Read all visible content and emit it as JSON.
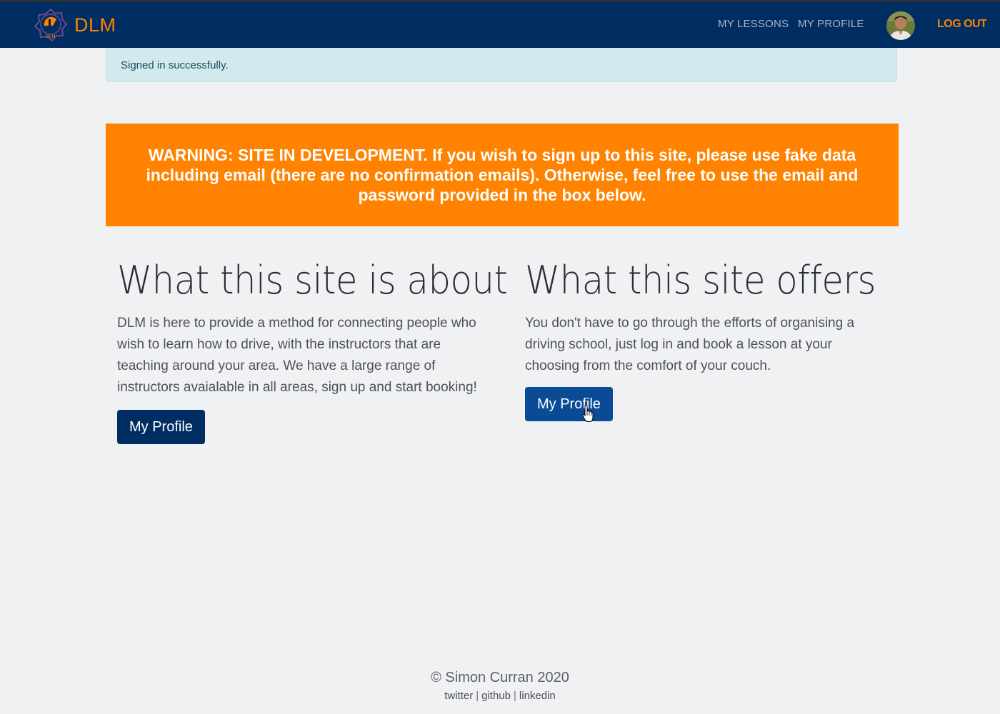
{
  "brand": {
    "name": "DLM",
    "logo_text": "DLM"
  },
  "nav": {
    "lessons_label": "MY LESSONS",
    "profile_label": "MY PROFILE",
    "logout_label": "LOG OUT"
  },
  "alert": {
    "text": "Signed in successfully."
  },
  "warning": {
    "text": "WARNING: SITE IN DEVELOPMENT. If you wish to sign up to this site, please use fake data including email (there are no confirmation emails). Otherwise, feel free to use the email and password provided in the box below."
  },
  "about": {
    "heading": "What this site is about",
    "body": "DLM is here to provide a method for connecting people who wish to learn how to drive, with the instructors that are teaching around your area. We have a large range of instructors avaialable in all areas, sign up and start booking!",
    "button_label": "My Profile"
  },
  "offers": {
    "heading": "What this site offers",
    "body": "You don't have to go through the efforts of organising a driving school, just log in and book a lesson at your choosing from the comfort of your couch.",
    "button_label": "My Profile"
  },
  "footer": {
    "copyright": "© Simon Curran 2020",
    "links": [
      "twitter",
      "github",
      "linkedin"
    ],
    "separator": "|"
  },
  "colors": {
    "navbar": "#002e63",
    "accent": "#ff8200",
    "background": "#f0f1f3",
    "alert_bg": "#d2e9ef",
    "button_hover": "#0a4b96"
  },
  "icons": {
    "logo": "dlm-logo-icon",
    "avatar": "user-avatar",
    "cursor": "hand-pointer-icon"
  }
}
